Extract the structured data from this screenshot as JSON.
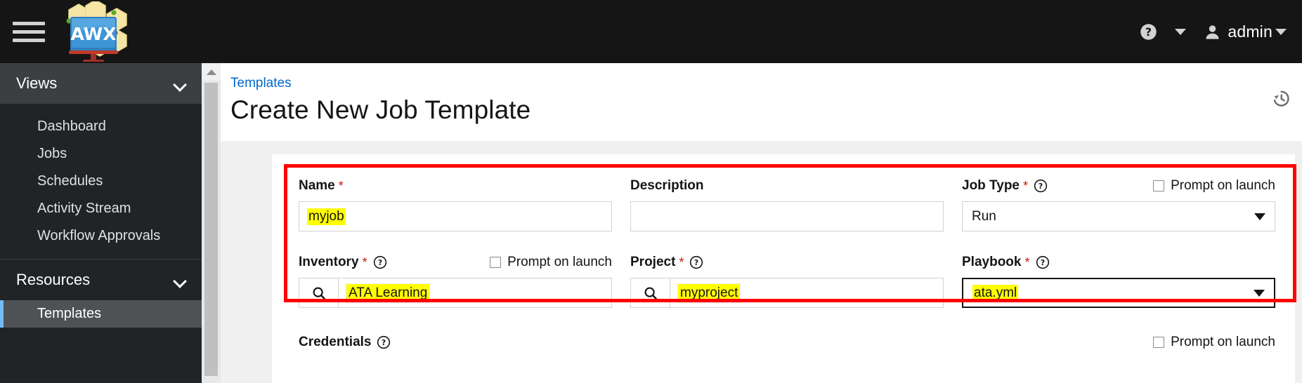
{
  "masthead": {
    "menu_toggle": "hamburger-menu",
    "brand": "AWX",
    "help_icon": "question-circle-icon",
    "help_caret": "chevron-down-icon",
    "user_icon": "user-icon",
    "user_name": "admin",
    "user_caret": "chevron-down-icon"
  },
  "sidebar": {
    "groups": [
      {
        "label": "Views",
        "expanded": true,
        "items": [
          {
            "label": "Dashboard",
            "active": false
          },
          {
            "label": "Jobs",
            "active": false
          },
          {
            "label": "Schedules",
            "active": false
          },
          {
            "label": "Activity Stream",
            "active": false
          },
          {
            "label": "Workflow Approvals",
            "active": false
          }
        ]
      },
      {
        "label": "Resources",
        "expanded": false,
        "items": [
          {
            "label": "Templates",
            "active": true
          }
        ]
      }
    ]
  },
  "page": {
    "breadcrumb": "Templates",
    "title": "Create New Job Template",
    "history_icon": "history-icon"
  },
  "form": {
    "name": {
      "label": "Name",
      "required": "*",
      "value": "myjob",
      "placeholder": ""
    },
    "description": {
      "label": "Description",
      "value": "",
      "placeholder": ""
    },
    "job_type": {
      "label": "Job Type",
      "required": "*",
      "help_icon": "question-circle-icon",
      "prompt_label": "Prompt on launch",
      "prompt_checked": false,
      "value": "Run",
      "caret": "caret-down-icon"
    },
    "inventory": {
      "label": "Inventory",
      "required": "*",
      "help_icon": "question-circle-icon",
      "prompt_label": "Prompt on launch",
      "prompt_checked": false,
      "search_icon": "search-icon",
      "value": "ATA Learning"
    },
    "project": {
      "label": "Project",
      "required": "*",
      "help_icon": "question-circle-icon",
      "search_icon": "search-icon",
      "value": "myproject"
    },
    "playbook": {
      "label": "Playbook",
      "required": "*",
      "help_icon": "question-circle-icon",
      "value": "ata.yml",
      "caret": "caret-down-icon",
      "focused": true
    },
    "credentials": {
      "label": "Credentials",
      "help_icon": "question-circle-icon",
      "prompt_label": "Prompt on launch",
      "prompt_checked": false
    }
  },
  "colors": {
    "masthead_bg": "#151515",
    "sidebar_bg": "#212427",
    "sidebar_active_bg": "#4f5255",
    "sidebar_accent": "#73bcf7",
    "link_blue": "#06c",
    "required_red": "#c9190b",
    "annotation_red": "#ff0000",
    "highlight_yellow": "#ffff00"
  }
}
